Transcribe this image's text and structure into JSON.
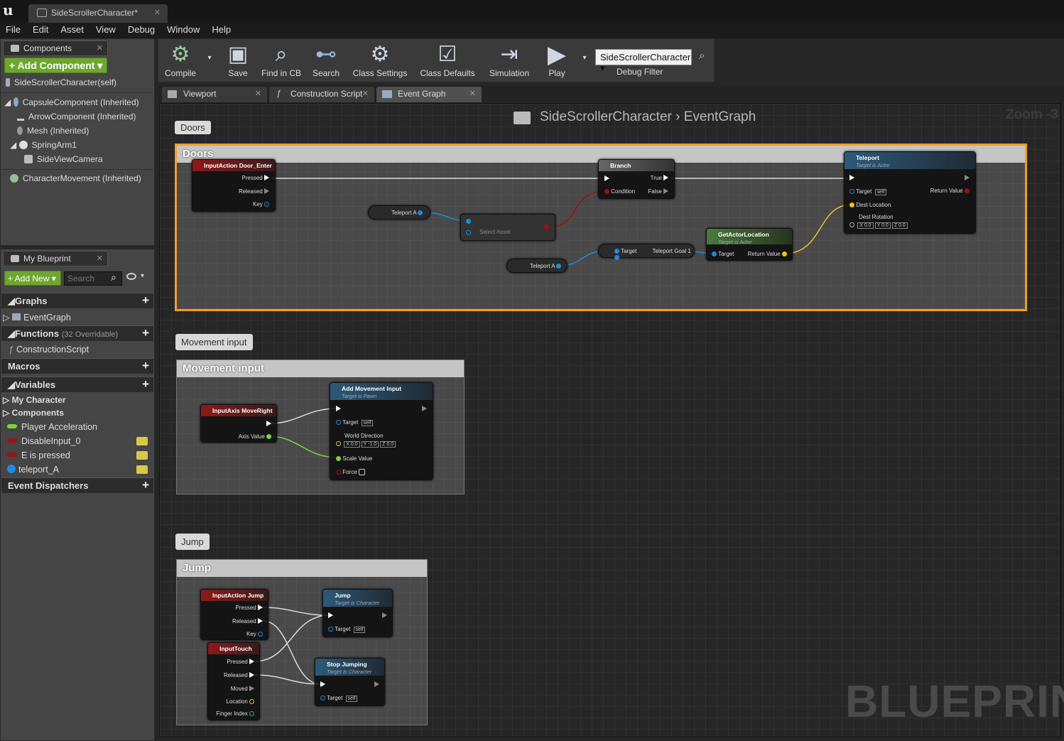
{
  "window": {
    "tab_title": "SideScrollerCharacter*"
  },
  "menu": [
    "File",
    "Edit",
    "Asset",
    "View",
    "Debug",
    "Window",
    "Help"
  ],
  "components_panel": {
    "tab": "Components",
    "add_button": "+ Add Component ▾",
    "self": "SideScrollerCharacter(self)",
    "tree": [
      "CapsuleComponent (Inherited)",
      "ArrowComponent (Inherited)",
      "Mesh (Inherited)",
      "SpringArm1",
      "SideViewCamera",
      "CharacterMovement (Inherited)"
    ]
  },
  "my_blueprint": {
    "tab": "My Blueprint",
    "add_new": "+ Add New ▾",
    "search_placeholder": "Search",
    "sections": {
      "graphs": "Graphs",
      "graph_items": [
        "EventGraph"
      ],
      "functions": "Functions",
      "functions_sub": "(32 Overridable)",
      "function_items": [
        "ConstructionScript"
      ],
      "macros": "Macros",
      "variables": "Variables",
      "var_groups": [
        "My Character",
        "Components"
      ],
      "variables_list": [
        {
          "name": "Player Acceleration",
          "color": "#7dd33a"
        },
        {
          "name": "DisableInput_0",
          "color": "#a01010"
        },
        {
          "name": "E is pressed",
          "color": "#a01010"
        },
        {
          "name": "teleport_A",
          "color": "#1a8ce0"
        }
      ],
      "dispatchers": "Event Dispatchers"
    }
  },
  "toolbar": {
    "compile": "Compile",
    "save": "Save",
    "find_in_cb": "Find in CB",
    "search": "Search",
    "class_settings": "Class Settings",
    "class_defaults": "Class Defaults",
    "simulation": "Simulation",
    "play": "Play",
    "debug_object": "SideScrollerCharacter ▾",
    "debug_filter": "Debug Filter"
  },
  "editor_tabs": [
    "Viewport",
    "Construction Script",
    "Event Graph"
  ],
  "graph": {
    "breadcrumb_class": "SideScrollerCharacter",
    "breadcrumb_graph": "EventGraph",
    "zoom": "Zoom -3",
    "watermark": "BLUEPRINT",
    "comments": [
      {
        "bubble": "Doors",
        "title": "Doors"
      },
      {
        "bubble": "Movement input",
        "title": "Movement input"
      },
      {
        "bubble": "Jump",
        "title": "Jump"
      }
    ],
    "nodes": {
      "door_enter": {
        "title": "InputAction Door_Enter",
        "pins": [
          "Pressed",
          "Released",
          "Key"
        ]
      },
      "branch": {
        "title": "Branch",
        "pins": [
          "True",
          "Condition",
          "False"
        ]
      },
      "teleport": {
        "title": "Teleport",
        "sub": "Target is Actor",
        "pins": [
          "Target",
          "Return Value",
          "Dest Location",
          "Dest Rotation"
        ],
        "self": "self",
        "rot": [
          "X 0.0",
          "Y 0.0",
          "Z 0.0"
        ]
      },
      "teleport_a1": "Teleport A",
      "teleport_a2": "Teleport A",
      "select": "Select Asset",
      "get_goal": {
        "target": "Target",
        "out": "Teleport Goal 1"
      },
      "get_actor_loc": {
        "title": "GetActorLocation",
        "sub": "Target is Actor",
        "pins": [
          "Target",
          "Return Value"
        ]
      },
      "move_right": {
        "title": "InputAxis MoveRight",
        "pins": [
          "Axis Value"
        ]
      },
      "add_move": {
        "title": "Add Movement Input",
        "sub": "Target is Pawn",
        "pins": [
          "Target",
          "World Direction",
          "Scale Value",
          "Force"
        ],
        "self": "self",
        "dir": [
          "X 0.0",
          "Y -1.0",
          "Z 0.0"
        ]
      },
      "jump_action": {
        "title": "InputAction Jump",
        "pins": [
          "Pressed",
          "Released",
          "Key"
        ]
      },
      "input_touch": {
        "title": "InputTouch",
        "pins": [
          "Pressed",
          "Released",
          "Moved",
          "Location",
          "Finger Index"
        ]
      },
      "jump": {
        "title": "Jump",
        "sub": "Target is Character",
        "pins": [
          "Target"
        ],
        "self": "self"
      },
      "stop_jump": {
        "title": "Stop Jumping",
        "sub": "Target is Character",
        "pins": [
          "Target"
        ],
        "self": "self"
      }
    }
  }
}
